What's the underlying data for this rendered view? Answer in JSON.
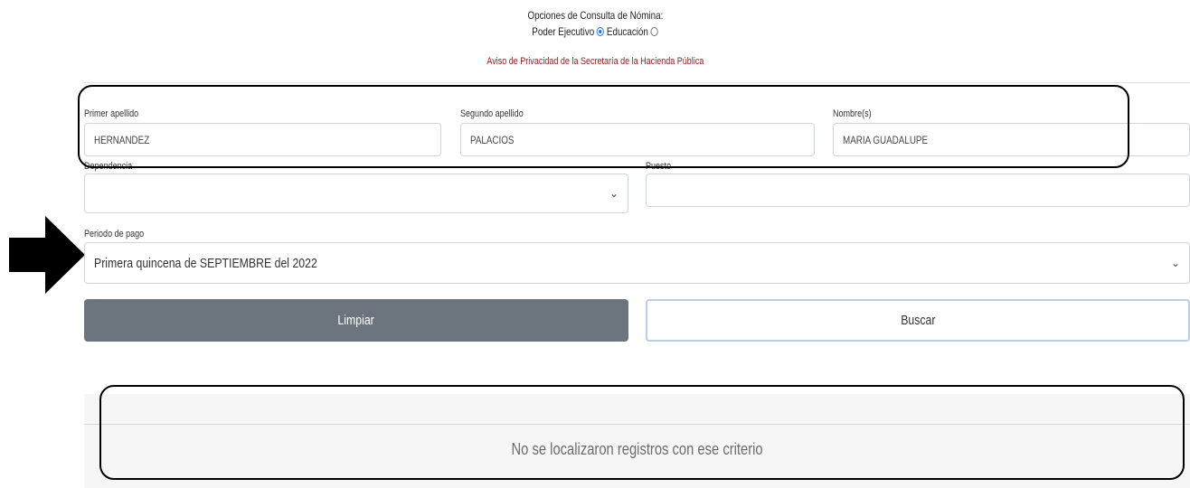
{
  "header": {
    "options_title": "Opciones de Consulta de Nómina:",
    "options": [
      {
        "label": "Poder Ejecutivo",
        "selected": true
      },
      {
        "label": "Educación",
        "selected": false
      }
    ],
    "privacy_link": "Aviso de Privacidad de la Secretaría de la Hacienda Pública"
  },
  "form": {
    "primer_apellido": {
      "label": "Primer apellido",
      "value": "HERNANDEZ"
    },
    "segundo_apellido": {
      "label": "Segundo apellido",
      "value": "PALACIOS"
    },
    "nombres": {
      "label": "Nombre(s)",
      "value": "MARIA GUADALUPE"
    },
    "dependencia": {
      "label": "Dependencia",
      "value": ""
    },
    "puesto": {
      "label": "Puesto",
      "value": ""
    },
    "periodo": {
      "label": "Periodo de pago",
      "value": "Primera quincena de SEPTIEMBRE del 2022"
    }
  },
  "buttons": {
    "clear": "Limpiar",
    "search": "Buscar"
  },
  "results": {
    "message": "No se localizaron registros con ese criterio"
  },
  "colors": {
    "clear_button": "#6c757d",
    "privacy_link": "#8b1a1a",
    "radio_selected": "#1a73e8"
  }
}
